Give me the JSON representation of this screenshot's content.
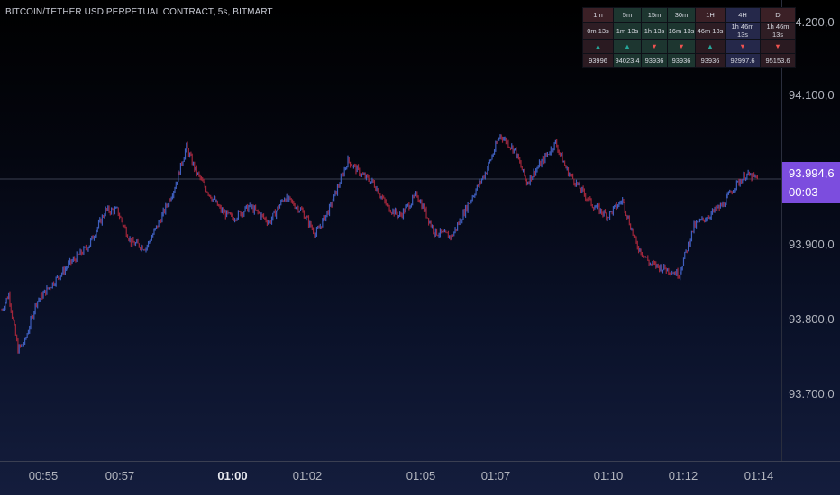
{
  "title": "BITCOIN/TETHER USD PERPETUAL CONTRACT, 5s, BITMART",
  "colors": {
    "up": "#3f5fbf",
    "down": "#a0263a",
    "accent": "#7c4dde"
  },
  "price_tag": {
    "price": "93.994,6",
    "countdown": "00:03"
  },
  "timeframe_table": {
    "headers": [
      "1m",
      "5m",
      "15m",
      "30m",
      "1H",
      "4H",
      "D"
    ],
    "times": [
      "0m 13s",
      "1m 13s",
      "1h 13s",
      "16m 13s",
      "46m 13s",
      "1h 46m 13s",
      "1h 46m 13s"
    ],
    "directions": [
      "up",
      "up",
      "down",
      "down",
      "up",
      "down",
      "down"
    ],
    "values": [
      "93996",
      "94023.4",
      "93936",
      "93936",
      "93936",
      "92997.6",
      "95153.6"
    ]
  },
  "chart_data": {
    "type": "bar",
    "ohlc_style": "tick-bars",
    "ylim": [
      93640,
      94220
    ],
    "y_ticks": [
      "94.200,0",
      "94.100,0",
      "93.900,0",
      "93.800,0",
      "93.700,0"
    ],
    "y_tick_values": [
      94200,
      94100,
      93900,
      93800,
      93700
    ],
    "x_tick_labels": [
      "00:55",
      "00:57",
      "01:00",
      "01:02",
      "01:05",
      "01:07",
      "01:10",
      "01:12",
      "01:14"
    ],
    "x_tick_bold": [
      false,
      false,
      true,
      false,
      false,
      false,
      false,
      false,
      false
    ],
    "current_price": 93994.6,
    "anchors": [
      [
        0,
        93830
      ],
      [
        6,
        93850
      ],
      [
        14,
        93780
      ],
      [
        20,
        93790
      ],
      [
        30,
        93840
      ],
      [
        45,
        93865
      ],
      [
        60,
        93890
      ],
      [
        75,
        93910
      ],
      [
        90,
        93955
      ],
      [
        100,
        93955
      ],
      [
        112,
        93915
      ],
      [
        125,
        93908
      ],
      [
        138,
        93945
      ],
      [
        150,
        93985
      ],
      [
        160,
        94035
      ],
      [
        168,
        94005
      ],
      [
        178,
        93980
      ],
      [
        190,
        93955
      ],
      [
        200,
        93945
      ],
      [
        215,
        93960
      ],
      [
        232,
        93940
      ],
      [
        245,
        93972
      ],
      [
        260,
        93955
      ],
      [
        272,
        93925
      ],
      [
        285,
        93960
      ],
      [
        300,
        94018
      ],
      [
        312,
        94000
      ],
      [
        322,
        93990
      ],
      [
        334,
        93960
      ],
      [
        345,
        93948
      ],
      [
        360,
        93975
      ],
      [
        375,
        93928
      ],
      [
        390,
        93922
      ],
      [
        405,
        93965
      ],
      [
        420,
        94005
      ],
      [
        432,
        94050
      ],
      [
        445,
        94030
      ],
      [
        455,
        93990
      ],
      [
        465,
        94010
      ],
      [
        480,
        94040
      ],
      [
        490,
        94005
      ],
      [
        500,
        93985
      ],
      [
        512,
        93962
      ],
      [
        525,
        93948
      ],
      [
        538,
        93968
      ],
      [
        550,
        93912
      ],
      [
        562,
        93888
      ],
      [
        575,
        93882
      ],
      [
        587,
        93875
      ],
      [
        600,
        93935
      ],
      [
        612,
        93948
      ],
      [
        625,
        93962
      ],
      [
        635,
        93985
      ],
      [
        645,
        94000
      ],
      [
        655,
        93994.6
      ]
    ]
  }
}
